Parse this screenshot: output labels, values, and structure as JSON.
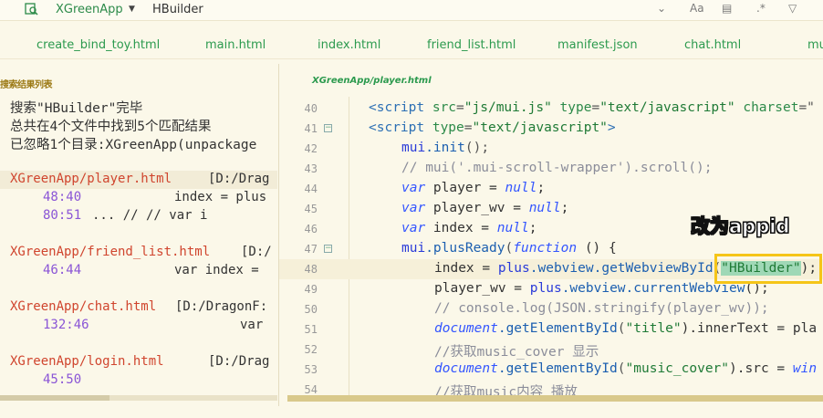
{
  "topbar": {
    "project": "XGreenApp",
    "search_value": "HBuilder",
    "icons": [
      "chevron-down-icon",
      "match-case-icon",
      "whole-word-icon",
      "regex-icon",
      "filter-icon"
    ]
  },
  "tabs": [
    "create_bind_toy.html",
    "main.html",
    "index.html",
    "friend_list.html",
    "manifest.json",
    "chat.html",
    "mu"
  ],
  "search_panel": {
    "title": "搜索结果列表",
    "summary": [
      "搜索\"HBuilder\"完毕",
      "总共在4个文件中找到5个匹配结果",
      "已忽略1个目录:XGreenApp(unpackage"
    ],
    "results": [
      {
        "file": "XGreenApp/player.html",
        "path": "[D:/Drag",
        "matches": [
          {
            "pos": "48:40",
            "code": "index = plus"
          },
          {
            "pos": "80:51",
            "code": "...   //      // var i"
          }
        ]
      },
      {
        "file": "XGreenApp/friend_list.html",
        "path": "[D:/",
        "matches": [
          {
            "pos": "46:44",
            "code": "var index ="
          }
        ]
      },
      {
        "file": "XGreenApp/chat.html",
        "path": "[D:/DragonF:",
        "matches": [
          {
            "pos": "132:46",
            "code": "var"
          }
        ]
      },
      {
        "file": "XGreenApp/login.html",
        "path": "[D:/Drag",
        "matches": [
          {
            "pos": "45:50",
            "code": ""
          }
        ]
      }
    ]
  },
  "editor": {
    "file_header": "XGreenApp/player.html",
    "line_numbers": [
      "40",
      "41",
      "42",
      "43",
      "44",
      "45",
      "46",
      "47",
      "48",
      "49",
      "50",
      "51",
      "52",
      "53",
      "54"
    ],
    "code": {
      "l40": {
        "p1": "<script ",
        "a1": "src",
        "p2": "=",
        "s1": "\"js/mui.js\"",
        "a2": " type",
        "p3": "=",
        "s2": "\"text/javascript\"",
        "a3": " charset",
        "p4": "=\""
      },
      "l41": {
        "p1": "<script ",
        "a1": "type",
        "p2": "=",
        "s1": "\"text/javascript\"",
        "p3": ">"
      },
      "l42": {
        "o": "mui",
        "f": ".init",
        "p": "();"
      },
      "l43": {
        "c": "// mui('.mui-scroll-wrapper').scroll();"
      },
      "l44": {
        "k": "var",
        "t": " player = ",
        "n": "null",
        "e": ";"
      },
      "l45": {
        "k": "var",
        "t": " player_wv = ",
        "n": "null",
        "e": ";"
      },
      "l46": {
        "k": "var",
        "t": " index = ",
        "n": "null",
        "e": ";"
      },
      "l47": {
        "o": "mui",
        "f": ".plusReady",
        "p": "(",
        "k": "function",
        "e": " () {"
      },
      "l48": {
        "t": "index = ",
        "o": "plus",
        "f": ".webview.getWebviewById",
        "p": "(",
        "s": "\"HBuilder\"",
        "e": ");"
      },
      "l49": {
        "t": "player_wv = ",
        "o": "plus",
        "f": ".webview.currentWebview",
        "e": "();"
      },
      "l50": {
        "c": "// console.log(JSON.stringify(player_wv));"
      },
      "l51": {
        "o": "document",
        "f": ".getElementById",
        "p": "(",
        "s": "\"title\"",
        "e": ").innerText = pla"
      },
      "l52": {
        "c": "//获取music_cover 显示"
      },
      "l53": {
        "o": "document",
        "f": ".getElementById",
        "p": "(",
        "s": "\"music_cover\"",
        "e": ").src = ",
        "w": "win"
      },
      "l54": {
        "c": "//获取music内容 播放"
      }
    }
  },
  "annotation": {
    "text": "改为appid",
    "color": "#f5c518"
  }
}
